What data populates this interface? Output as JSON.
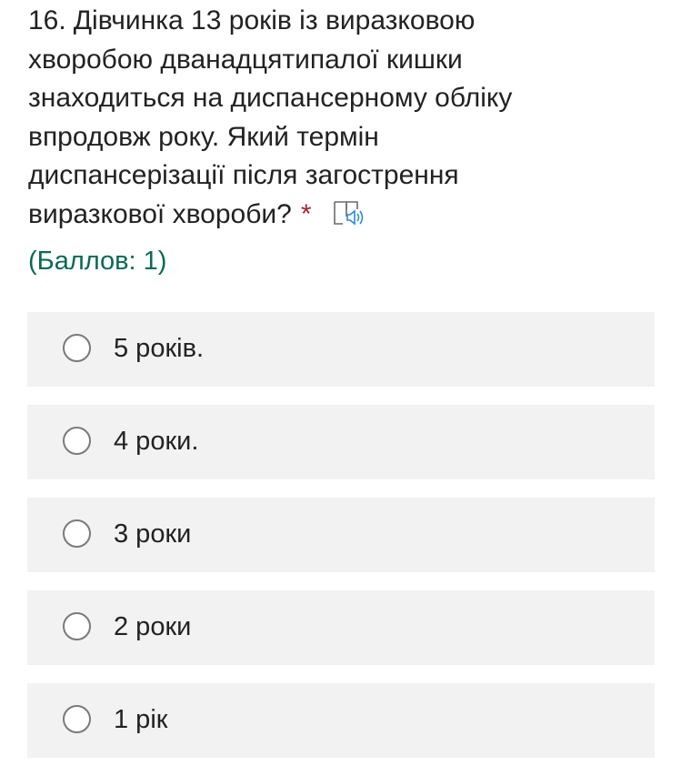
{
  "question": {
    "number": "16.",
    "lines": [
      "Дівчинка 13 років із виразковою",
      "хворобою дванадцятипалої кишки",
      "знаходиться на диспансерному обліку",
      "впродовж року. Який термін",
      "диспансерізації після загострення",
      "виразкової хвороби?"
    ],
    "required_mark": "*",
    "reader_icon": "immersive-reader-icon",
    "points": "(Баллов: 1)"
  },
  "options": [
    {
      "label": "5 років."
    },
    {
      "label": "4 роки."
    },
    {
      "label": "3 роки"
    },
    {
      "label": "2 роки"
    },
    {
      "label": "1 рік"
    }
  ],
  "colors": {
    "text": "#222222",
    "required": "#a4262c",
    "points": "#0b6a55",
    "option_bg": "#f2f2f2",
    "radio_border": "#7a7a7a",
    "icon_accent": "#2b88d8"
  }
}
